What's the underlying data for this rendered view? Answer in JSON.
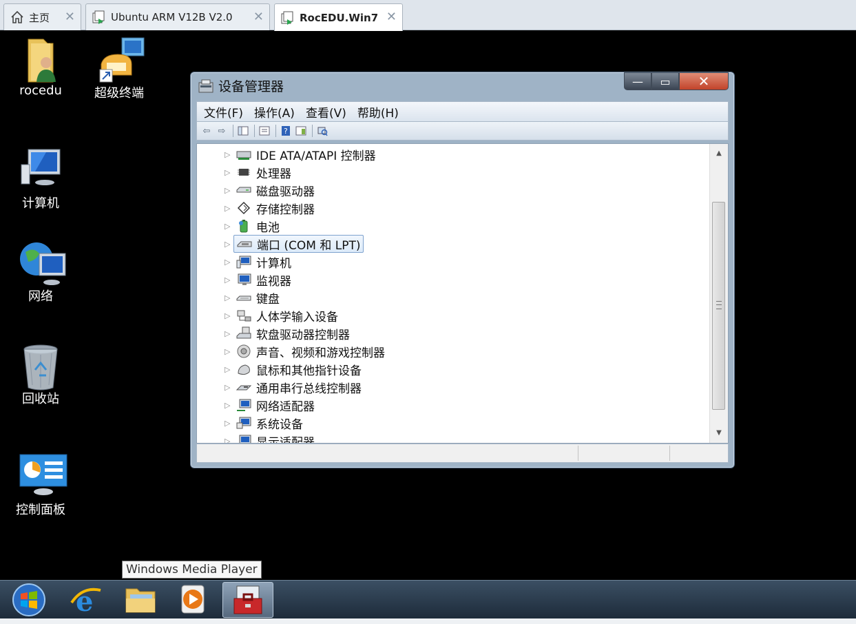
{
  "tabs": [
    {
      "label": "主页",
      "icon": "home-icon"
    },
    {
      "label": "Ubuntu ARM V12B V2.0",
      "icon": "vm-icon"
    },
    {
      "label": "RocEDU.Win7",
      "icon": "vm-icon",
      "active": true
    }
  ],
  "desktop_icons": [
    {
      "label": "rocedu",
      "icon": "user-folder-icon"
    },
    {
      "label": "超级终端",
      "icon": "hyperterminal-icon"
    },
    {
      "label": "计算机",
      "icon": "computer-icon"
    },
    {
      "label": "网络",
      "icon": "network-icon"
    },
    {
      "label": "回收站",
      "icon": "recycle-bin-icon"
    },
    {
      "label": "控制面板",
      "icon": "control-panel-icon"
    }
  ],
  "window": {
    "title": "设备管理器",
    "buttons": {
      "minimize": "—",
      "maximize": "▭",
      "close": "✕"
    },
    "menu": [
      "文件(F)",
      "操作(A)",
      "查看(V)",
      "帮助(H)"
    ],
    "toolbar_icons": [
      "back-arrow-icon",
      "forward-arrow-icon",
      "show-hide-tree-icon",
      "properties-icon",
      "help-icon",
      "action-pane-icon",
      "scan-hardware-icon"
    ],
    "tree": [
      {
        "label": "IDE ATA/ATAPI 控制器",
        "icon": "ide-controller-icon"
      },
      {
        "label": "处理器",
        "icon": "processor-icon"
      },
      {
        "label": "磁盘驱动器",
        "icon": "disk-drive-icon"
      },
      {
        "label": "存储控制器",
        "icon": "storage-controller-icon"
      },
      {
        "label": "电池",
        "icon": "battery-icon"
      },
      {
        "label": "端口 (COM 和 LPT)",
        "icon": "port-icon",
        "selected": true
      },
      {
        "label": "计算机",
        "icon": "computer-icon"
      },
      {
        "label": "监视器",
        "icon": "monitor-icon"
      },
      {
        "label": "键盘",
        "icon": "keyboard-icon"
      },
      {
        "label": "人体学输入设备",
        "icon": "hid-icon"
      },
      {
        "label": "软盘驱动器控制器",
        "icon": "floppy-controller-icon"
      },
      {
        "label": "声音、视频和游戏控制器",
        "icon": "sound-icon"
      },
      {
        "label": "鼠标和其他指针设备",
        "icon": "mouse-icon"
      },
      {
        "label": "通用串行总线控制器",
        "icon": "usb-icon"
      },
      {
        "label": "网络适配器",
        "icon": "network-adapter-icon"
      },
      {
        "label": "系统设备",
        "icon": "system-device-icon"
      },
      {
        "label": "显示适配器",
        "icon": "display-adapter-icon"
      }
    ]
  },
  "tooltip": "Windows Media Player",
  "taskbar": [
    {
      "name": "start-button",
      "icon": "windows-orb-icon"
    },
    {
      "name": "taskbar-ie",
      "icon": "internet-explorer-icon"
    },
    {
      "name": "taskbar-explorer",
      "icon": "folder-icon"
    },
    {
      "name": "taskbar-media-player",
      "icon": "media-player-icon"
    },
    {
      "name": "taskbar-device-manager",
      "icon": "toolbox-icon",
      "active": true
    }
  ]
}
